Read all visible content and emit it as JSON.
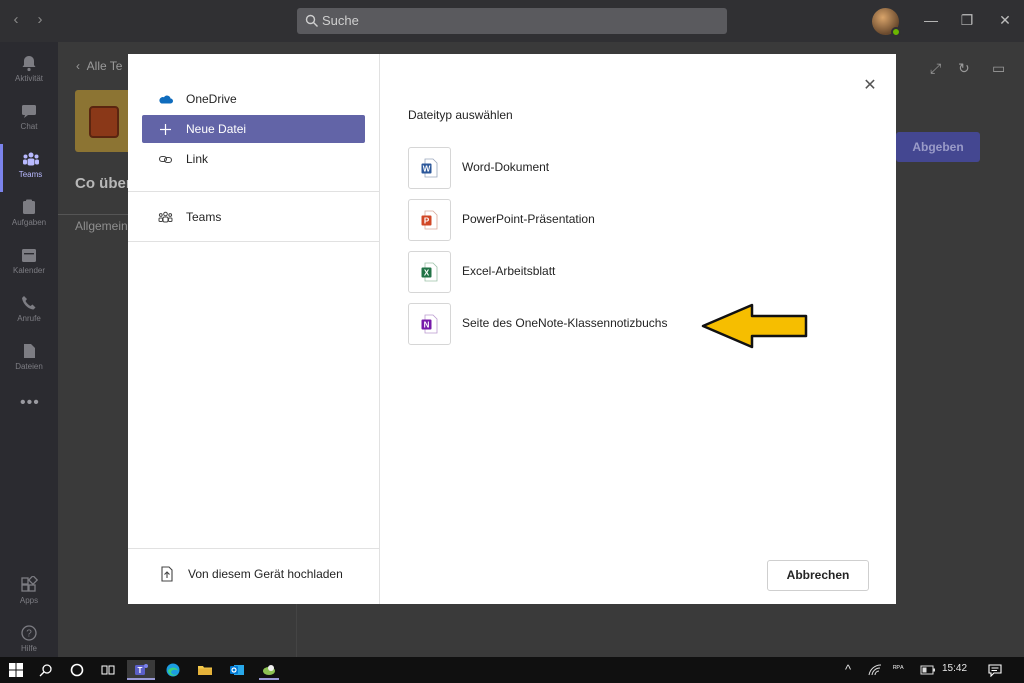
{
  "search": {
    "placeholder": "Suche"
  },
  "rail": {
    "items": [
      {
        "label": "Aktivität",
        "icon": "bell-icon"
      },
      {
        "label": "Chat",
        "icon": "chat-icon"
      },
      {
        "label": "Teams",
        "icon": "teams-icon",
        "active": true
      },
      {
        "label": "Aufgaben",
        "icon": "assignments-icon"
      },
      {
        "label": "Kalender",
        "icon": "calendar-icon"
      },
      {
        "label": "Anrufe",
        "icon": "phone-icon"
      },
      {
        "label": "Dateien",
        "icon": "files-icon"
      }
    ],
    "more": "•••",
    "apps_label": "Apps",
    "help_label": "Hilfe"
  },
  "background": {
    "back_label": "Alle Te",
    "heading": "Co über",
    "tab": "Allgemein",
    "submit_label": "Abgeben"
  },
  "modal": {
    "sources": [
      {
        "label": "OneDrive",
        "icon": "onedrive-cloud-icon"
      },
      {
        "label": "Neue Datei",
        "icon": "plus-icon",
        "selected": true
      },
      {
        "label": "Link",
        "icon": "link-icon"
      }
    ],
    "teams_label": "Teams",
    "upload_label": "Von diesem Gerät hochladen",
    "section_title": "Dateityp auswählen",
    "file_types": [
      {
        "label": "Word-Dokument",
        "icon": "word-icon",
        "color": "#2b579a",
        "letter": "W"
      },
      {
        "label": "PowerPoint-Präsentation",
        "icon": "powerpoint-icon",
        "color": "#d24726",
        "letter": "P"
      },
      {
        "label": "Excel-Arbeitsblatt",
        "icon": "excel-icon",
        "color": "#217346",
        "letter": "X"
      },
      {
        "label": "Seite des OneNote-Klassennotizbuchs",
        "icon": "onenote-icon",
        "color": "#7719aa",
        "letter": "N"
      }
    ],
    "cancel_label": "Abbrechen",
    "close_glyph": "✕"
  },
  "taskbar": {
    "time": "15:42",
    "lang": "ᴿᴾᴬ"
  },
  "colors": {
    "accent": "#6264a7",
    "annotation_arrow": "#f6be00"
  }
}
